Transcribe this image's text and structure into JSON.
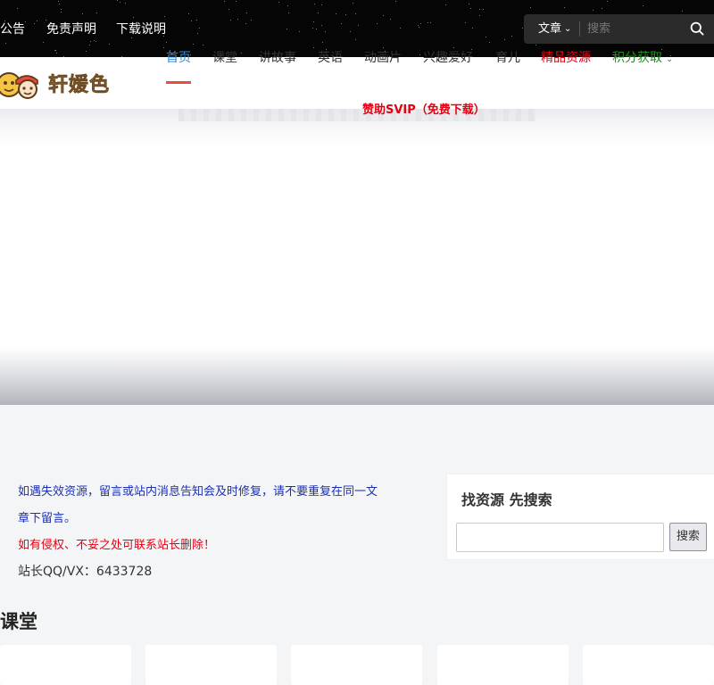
{
  "topbar": {
    "links": [
      "公告",
      "免责声明",
      "下载说明"
    ]
  },
  "search": {
    "category": "文章",
    "placeholder": "搜索"
  },
  "logo": {
    "text": "轩媛色"
  },
  "nav": {
    "items": [
      "首页",
      "课堂",
      "讲故事",
      "英语",
      "动画片",
      "兴趣爱好",
      "育儿",
      "精品资源",
      "积分获取"
    ],
    "sponsor": "赞助SVIP（免费下载）"
  },
  "notices": {
    "line1": "如遇失效资源，留言或站内消息告知会及时修复，请不要重复在同一文",
    "line2": "章下留言。",
    "line3": "如有侵权、不妥之处可联系站长删除！",
    "line4": "站长QQ/VX：6433728"
  },
  "widget": {
    "title": "找资源 先搜索",
    "input_value": "",
    "button": "搜索"
  },
  "section": {
    "title": "课堂"
  },
  "colors": {
    "accent": "#2e86de",
    "active_underline": "#e74c3c",
    "highlight_red": "#e60012",
    "highlight_green": "#1a8f1a",
    "notice_blue": "#1c2fb0"
  },
  "icons": [
    "chevron-down-icon",
    "search-icon",
    "logo-icon"
  ]
}
